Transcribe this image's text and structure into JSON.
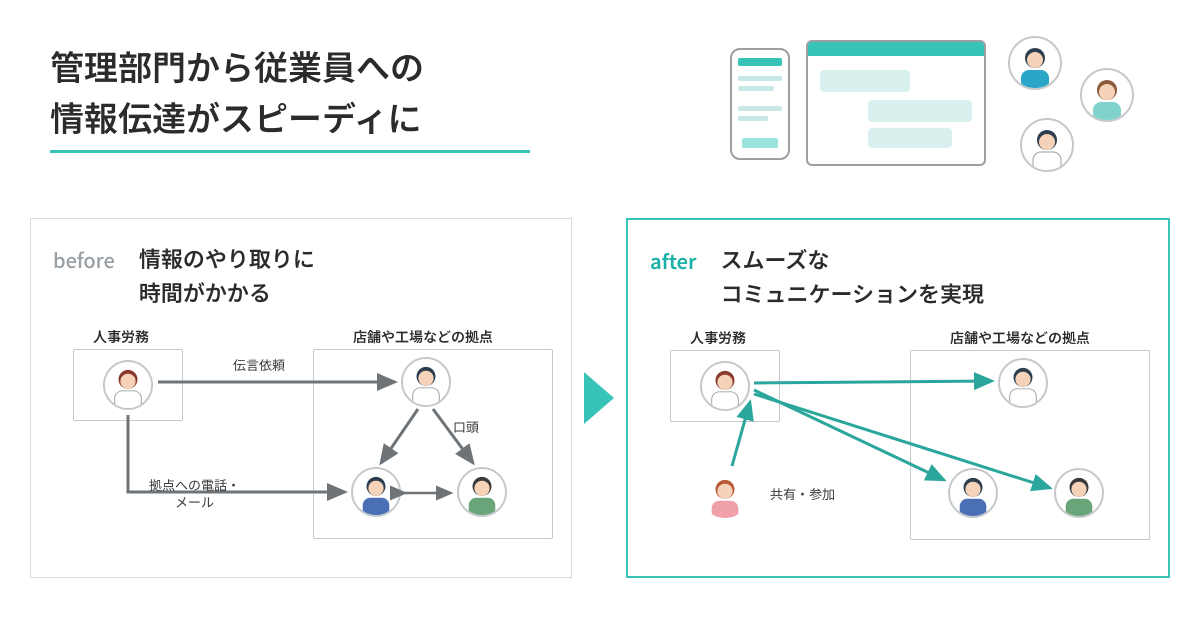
{
  "header": {
    "headline_line1": "管理部門から従業員への",
    "headline_line2": "情報伝達がスピーディに"
  },
  "before": {
    "badge": "before",
    "title": "情報のやり取りに\n時間がかかる",
    "hr_label": "人事労務",
    "site_label": "店舗や工場などの拠点",
    "edge_request": "伝言依頼",
    "edge_verbal": "口頭",
    "edge_phone_mail": "拠点への電話・\nメール"
  },
  "after": {
    "badge": "after",
    "title": "スムーズな\nコミュニケーションを実現",
    "hr_label": "人事労務",
    "site_label": "店舗や工場などの拠点",
    "edge_share": "共有・参加"
  },
  "colors": {
    "accent": "#38c3b9",
    "muted": "#98a0a5",
    "line_gray": "#6d7377"
  }
}
